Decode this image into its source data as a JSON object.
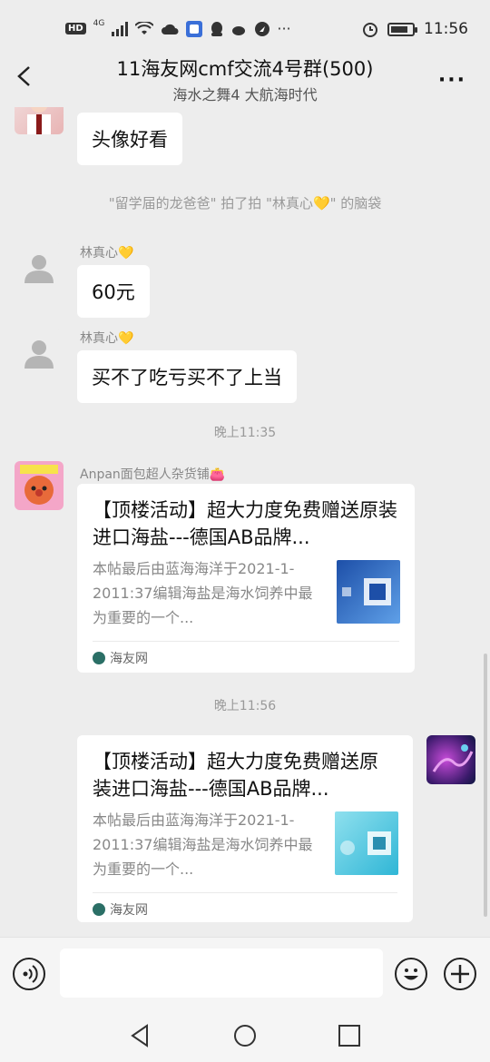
{
  "status_bar": {
    "network_badge": "HD",
    "network_type": "4G",
    "time": "11:56",
    "battery_level": 0.8
  },
  "header": {
    "title": "11海友网cmf交流4号群(500)",
    "subtitle": "海水之舞4 大航海时代"
  },
  "messages": [
    {
      "text": "头像好看"
    },
    {
      "system_text": "\"留学届的龙爸爸\" 拍了拍 \"林真心💛\" 的脑袋"
    },
    {
      "sender": "林真心💛",
      "text": "60元"
    },
    {
      "sender": "林真心💛",
      "text": "买不了吃亏买不了上当"
    },
    {
      "time": "晚上11:35"
    },
    {
      "sender": "Anpan面包超人杂货铺👛",
      "card": {
        "title": "【顶楼活动】超大力度免费赠送原装进口海盐---德国AB品牌...",
        "desc": "本帖最后由蓝海海洋于2021-1-2011:37编辑海盐是海水饲养中最为重要的一个...",
        "source": "海友网"
      }
    },
    {
      "time": "晚上11:56"
    },
    {
      "card": {
        "title": "【顶楼活动】超大力度免费赠送原装进口海盐---德国AB品牌...",
        "desc": "本帖最后由蓝海海洋于2021-1-2011:37编辑海盐是海水饲养中最为重要的一个...",
        "source": "海友网"
      }
    }
  ],
  "input_bar": {
    "placeholder": ""
  },
  "colors": {
    "background": "#ededed",
    "bubble": "#ffffff",
    "system_text": "#999999"
  }
}
